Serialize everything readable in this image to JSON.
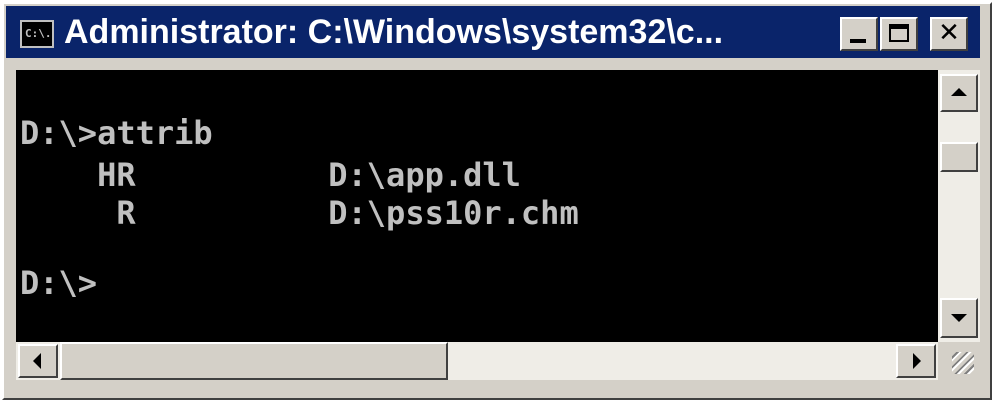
{
  "window": {
    "title": "Administrator: C:\\Windows\\system32\\c...",
    "icon": "cmd-prompt-icon",
    "icon_text": "C:\\."
  },
  "caption_buttons": {
    "close": "✕"
  },
  "console": {
    "lines": [
      "D:\\>attrib",
      "    HR          D:\\app.dll",
      "     R          D:\\pss10r.chm",
      "",
      "D:\\>"
    ]
  },
  "scroll": {
    "vertical_position": 0.1,
    "horizontal_thumb": 0.43
  },
  "colors": {
    "title_bar": "#0a246a",
    "console_bg": "#000000",
    "console_text": "#c0c0c0",
    "chrome": "#d4d0c8"
  }
}
